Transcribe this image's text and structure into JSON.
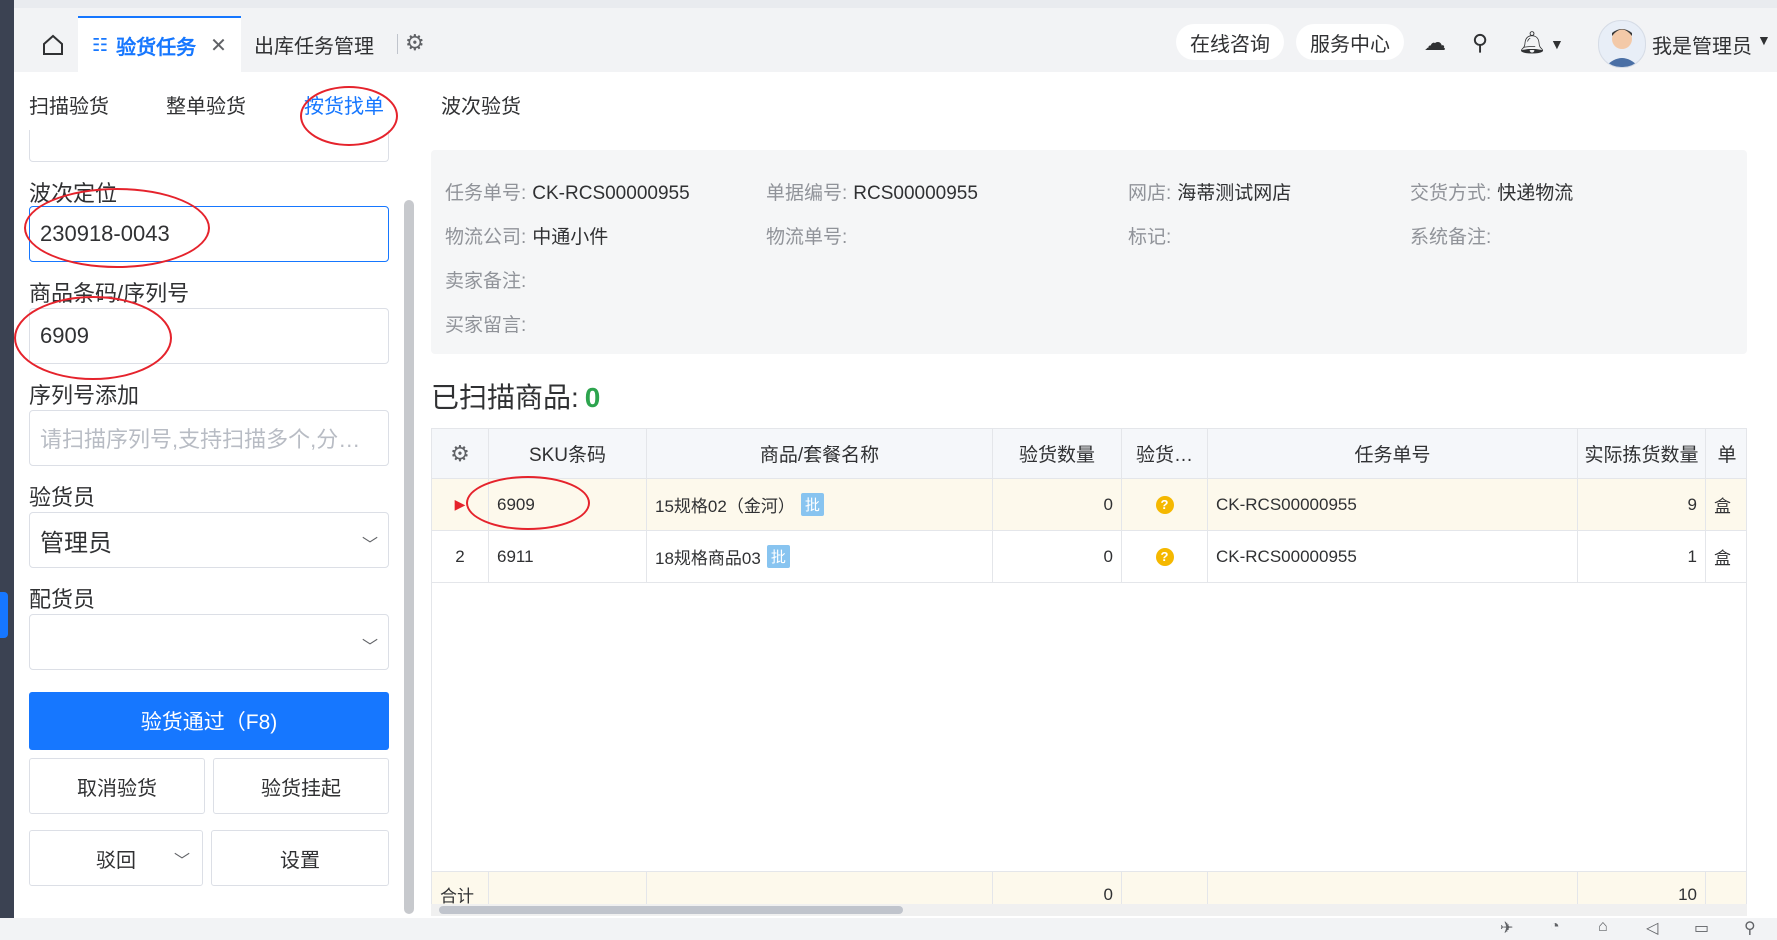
{
  "header": {
    "tabs": [
      {
        "label": "验货任务",
        "active": true
      },
      {
        "label": "出库任务管理",
        "active": false
      }
    ],
    "buttons": {
      "online_consult": "在线咨询",
      "service_center": "服务中心"
    },
    "user_name": "我是管理员"
  },
  "subtabs": [
    "扫描验货",
    "整单验货",
    "按货找单",
    "波次验货"
  ],
  "form": {
    "wave_label": "波次定位",
    "wave_value": "230918-0043",
    "barcode_label": "商品条码/序列号",
    "barcode_value": "6909",
    "serial_label": "序列号添加",
    "serial_placeholder": "请扫描序列号,支持扫描多个,分…",
    "inspector_label": "验货员",
    "inspector_value": "管理员",
    "picker_label": "配货员",
    "picker_value": ""
  },
  "actions": {
    "pass": "验货通过（F8)",
    "cancel": "取消验货",
    "hang": "验货挂起",
    "reject": "驳回",
    "settings": "设置"
  },
  "info": {
    "task_no_label": "任务单号:",
    "task_no": "CK-RCS00000955",
    "doc_no_label": "单据编号:",
    "doc_no": "RCS00000955",
    "shop_label": "网店:",
    "shop": "海蒂测试网店",
    "delivery_label": "交货方式:",
    "delivery": "快递物流",
    "logistics_label": "物流公司:",
    "logistics": "中通小件",
    "tracking_label": "物流单号:",
    "mark_label": "标记:",
    "sys_note_label": "系统备注:",
    "seller_note_label": "卖家备注:",
    "buyer_msg_label": "买家留言:"
  },
  "scanned": {
    "label": "已扫描商品:",
    "count": "0"
  },
  "table": {
    "headers": [
      "SKU条码",
      "商品/套餐名称",
      "验货数量",
      "验货…",
      "任务单号",
      "实际拣货数量",
      "单"
    ],
    "rows": [
      {
        "index": "",
        "sku": "6909",
        "name": "15规格02（金河）",
        "tag": "批",
        "qty": "0",
        "task": "CK-RCS00000955",
        "picked": "9",
        "unit": "盒"
      },
      {
        "index": "2",
        "sku": "6911",
        "name": "18规格商品03",
        "tag": "批",
        "qty": "0",
        "task": "CK-RCS00000955",
        "picked": "1",
        "unit": "盒"
      }
    ],
    "total": {
      "label": "合计",
      "qty": "0",
      "picked": "10"
    }
  },
  "colors": {
    "primary": "#1677ff",
    "highlight_row": "#fdf9ec",
    "count_green": "#2da44e",
    "annotation": "#e5232c"
  }
}
